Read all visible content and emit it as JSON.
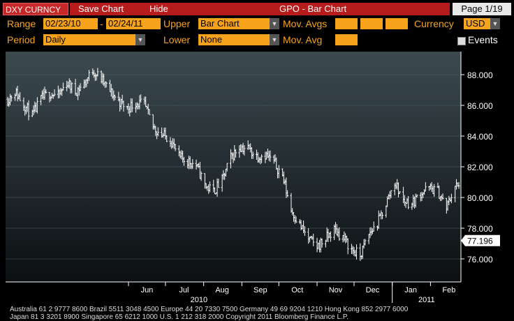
{
  "header": {
    "ticker": "DXY CURNCY",
    "save_chart": "Save Chart",
    "hide": "Hide",
    "chart_title": "GPO - Bar Chart",
    "page": "Page 1/19"
  },
  "controls": {
    "range_label": "Range",
    "range_start": "02/23/10",
    "range_sep": "-",
    "range_end": "02/24/11",
    "upper_label": "Upper",
    "upper_value": "Bar Chart",
    "mov_avgs_label": "Mov. Avgs",
    "currency_label": "Currency",
    "currency_value": "USD",
    "period_label": "Period",
    "period_value": "Daily",
    "lower_label": "Lower",
    "lower_value": "None",
    "mov_avg_label": "Mov. Avg",
    "events_label": "Events"
  },
  "footer": {
    "line1": "Australia 61 2 9777 8600 Brazil 5511 3048 4500 Europe 44 20 7330 7500 Germany 49 69 9204 1210 Hong Kong 852 2977 6000",
    "line2": "Japan 81 3 3201 8900          Singapore 65 6212 1000          U.S. 1 212 318 2000          Copyright 2011 Bloomberg Finance L.P."
  },
  "chart_data": {
    "type": "bar",
    "title": "",
    "ylim": [
      74.5,
      89.5
    ],
    "y_ticks": [
      76,
      78,
      80,
      82,
      84,
      86,
      88
    ],
    "y_tick_labels": [
      "76.000",
      "78.000",
      "80.000",
      "82.000",
      "84.000",
      "86.000",
      "88.000"
    ],
    "x_range": [
      "2010-02-23",
      "2011-02-24"
    ],
    "month_labels": [
      {
        "label": "Jun",
        "date": "2010-06-01"
      },
      {
        "label": "Jul",
        "date": "2010-07-01"
      },
      {
        "label": "Aug",
        "date": "2010-08-01"
      },
      {
        "label": "Sep",
        "date": "2010-09-01"
      },
      {
        "label": "Oct",
        "date": "2010-10-01"
      },
      {
        "label": "Nov",
        "date": "2010-11-01"
      },
      {
        "label": "Dec",
        "date": "2010-12-01"
      },
      {
        "label": "Jan",
        "date": "2011-01-01"
      },
      {
        "label": "Feb",
        "date": "2011-02-01"
      }
    ],
    "year_labels": [
      {
        "label": "2010",
        "date": "2010-07-01"
      },
      {
        "label": "2011",
        "date": "2011-01-01"
      }
    ],
    "last_value": 77.196,
    "last_value_label": "77.196",
    "grid": true,
    "series": [
      {
        "points": [
          [
            "2010-02-23",
            86.4
          ],
          [
            "2010-03-01",
            86.9
          ],
          [
            "2010-03-08",
            86.1
          ],
          [
            "2010-03-15",
            85.3
          ],
          [
            "2010-03-22",
            86.4
          ],
          [
            "2010-03-29",
            86.8
          ],
          [
            "2010-04-05",
            86.6
          ],
          [
            "2010-04-12",
            87.5
          ],
          [
            "2010-04-19",
            86.9
          ],
          [
            "2010-04-26",
            87.4
          ],
          [
            "2010-05-03",
            88.3
          ],
          [
            "2010-05-10",
            87.7
          ],
          [
            "2010-05-17",
            86.9
          ],
          [
            "2010-05-24",
            86.3
          ],
          [
            "2010-05-31",
            85.8
          ],
          [
            "2010-06-07",
            86.2
          ],
          [
            "2010-06-14",
            86.0
          ],
          [
            "2010-06-21",
            84.6
          ],
          [
            "2010-06-28",
            84.1
          ],
          [
            "2010-07-05",
            83.8
          ],
          [
            "2010-07-12",
            82.6
          ],
          [
            "2010-07-19",
            82.4
          ],
          [
            "2010-07-26",
            82.1
          ],
          [
            "2010-08-02",
            80.8
          ],
          [
            "2010-08-09",
            80.4
          ],
          [
            "2010-08-16",
            81.1
          ],
          [
            "2010-08-23",
            82.6
          ],
          [
            "2010-08-30",
            83.3
          ],
          [
            "2010-09-06",
            83.2
          ],
          [
            "2010-09-13",
            82.7
          ],
          [
            "2010-09-20",
            82.8
          ],
          [
            "2010-09-27",
            82.3
          ],
          [
            "2010-10-04",
            81.4
          ],
          [
            "2010-10-11",
            79.2
          ],
          [
            "2010-10-18",
            78.2
          ],
          [
            "2010-10-25",
            77.3
          ],
          [
            "2010-11-01",
            76.8
          ],
          [
            "2010-11-08",
            77.3
          ],
          [
            "2010-11-15",
            77.9
          ],
          [
            "2010-11-22",
            77.4
          ],
          [
            "2010-11-29",
            76.6
          ],
          [
            "2010-12-06",
            76.2
          ],
          [
            "2010-12-13",
            77.6
          ],
          [
            "2010-12-20",
            78.3
          ],
          [
            "2010-12-27",
            79.6
          ],
          [
            "2011-01-03",
            81.0
          ],
          [
            "2011-01-10",
            79.8
          ],
          [
            "2011-01-17",
            79.6
          ],
          [
            "2011-01-24",
            80.3
          ],
          [
            "2011-01-31",
            80.6
          ],
          [
            "2011-02-07",
            80.4
          ],
          [
            "2011-02-14",
            79.3
          ],
          [
            "2011-02-21",
            80.8
          ],
          [
            "2011-02-24",
            80.6
          ]
        ]
      }
    ]
  }
}
